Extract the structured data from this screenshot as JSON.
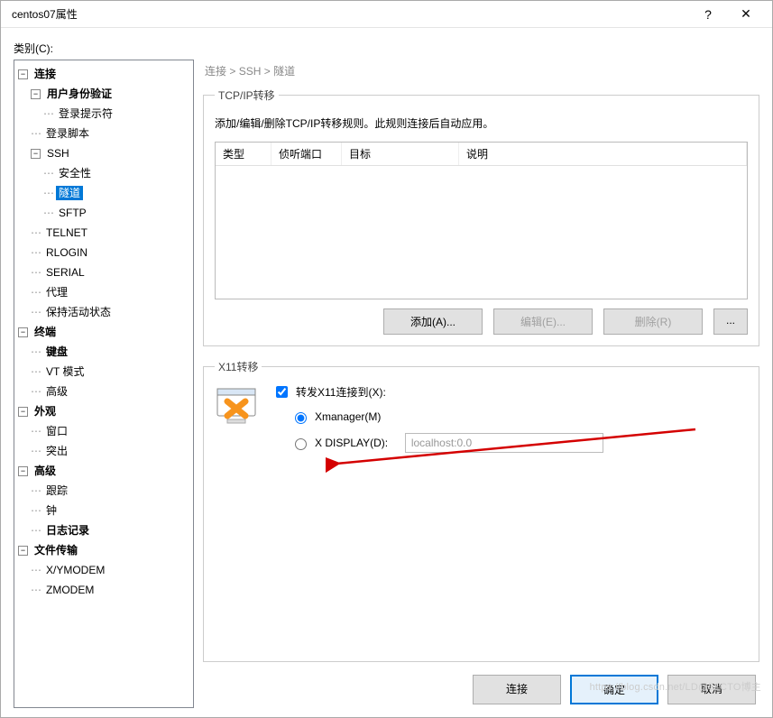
{
  "window": {
    "title": "centos07属性"
  },
  "category_label": "类别(C):",
  "tree": {
    "connection": "连接",
    "user_auth": "用户身份验证",
    "login_prompt": "登录提示符",
    "login_script": "登录脚本",
    "ssh": "SSH",
    "security": "安全性",
    "tunnel": "隧道",
    "sftp": "SFTP",
    "telnet": "TELNET",
    "rlogin": "RLOGIN",
    "serial": "SERIAL",
    "proxy": "代理",
    "keepalive": "保持活动状态",
    "terminal": "终端",
    "keyboard": "键盘",
    "vt_mode": "VT 模式",
    "advanced_term": "高级",
    "appearance": "外观",
    "window": "窗口",
    "highlight": "突出",
    "advanced": "高级",
    "trace": "跟踪",
    "bell": "钟",
    "logging": "日志记录",
    "file_transfer": "文件传输",
    "xy_modem": "X/YMODEM",
    "z_modem": "ZMODEM"
  },
  "breadcrumb": {
    "a": "连接",
    "b": "SSH",
    "c": "隧道",
    "sep": ">"
  },
  "tcpip": {
    "legend": "TCP/IP转移",
    "desc": "添加/编辑/删除TCP/IP转移规则。此规则连接后自动应用。",
    "cols": {
      "type": "类型",
      "listen": "侦听端口",
      "target": "目标",
      "desc": "说明"
    },
    "buttons": {
      "add": "添加(A)...",
      "edit": "编辑(E)...",
      "delete": "删除(R)",
      "more": "..."
    }
  },
  "x11": {
    "legend": "X11转移",
    "forward": "转发X11连接到(X):",
    "xmanager": "Xmanager(M)",
    "xdisplay": "X DISPLAY(D):",
    "display_value": "localhost:0.0",
    "forward_checked": true,
    "option_selected": "xmanager"
  },
  "footer": {
    "connect": "连接",
    "ok": "确定",
    "cancel": "取消"
  },
  "watermark": "https://blog.csdn.net/LD@51CTO博主"
}
